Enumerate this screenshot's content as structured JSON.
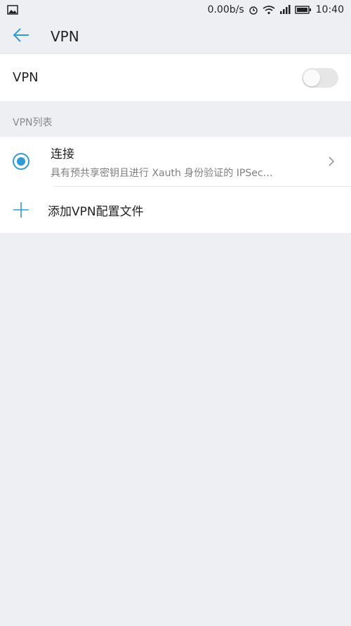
{
  "statusbar": {
    "speed": "0.00b/s",
    "time": "10:40",
    "icons": [
      "image-icon",
      "alarm-icon",
      "wifi-icon",
      "signal-icon",
      "battery-icon"
    ]
  },
  "header": {
    "title": "VPN",
    "back_icon": "back-arrow-icon"
  },
  "vpn_toggle": {
    "label": "VPN",
    "enabled": false
  },
  "vpn_list": {
    "section_label": "VPN列表",
    "items": [
      {
        "title": "连接",
        "subtitle": "具有预共享密钥且进行 Xauth 身份验证的 IPSec…",
        "selected": true
      }
    ]
  },
  "add_profile": {
    "label": "添加VPN配置文件",
    "icon": "plus-icon"
  },
  "colors": {
    "accent": "#2f9bd6",
    "background": "#eeeff2"
  }
}
